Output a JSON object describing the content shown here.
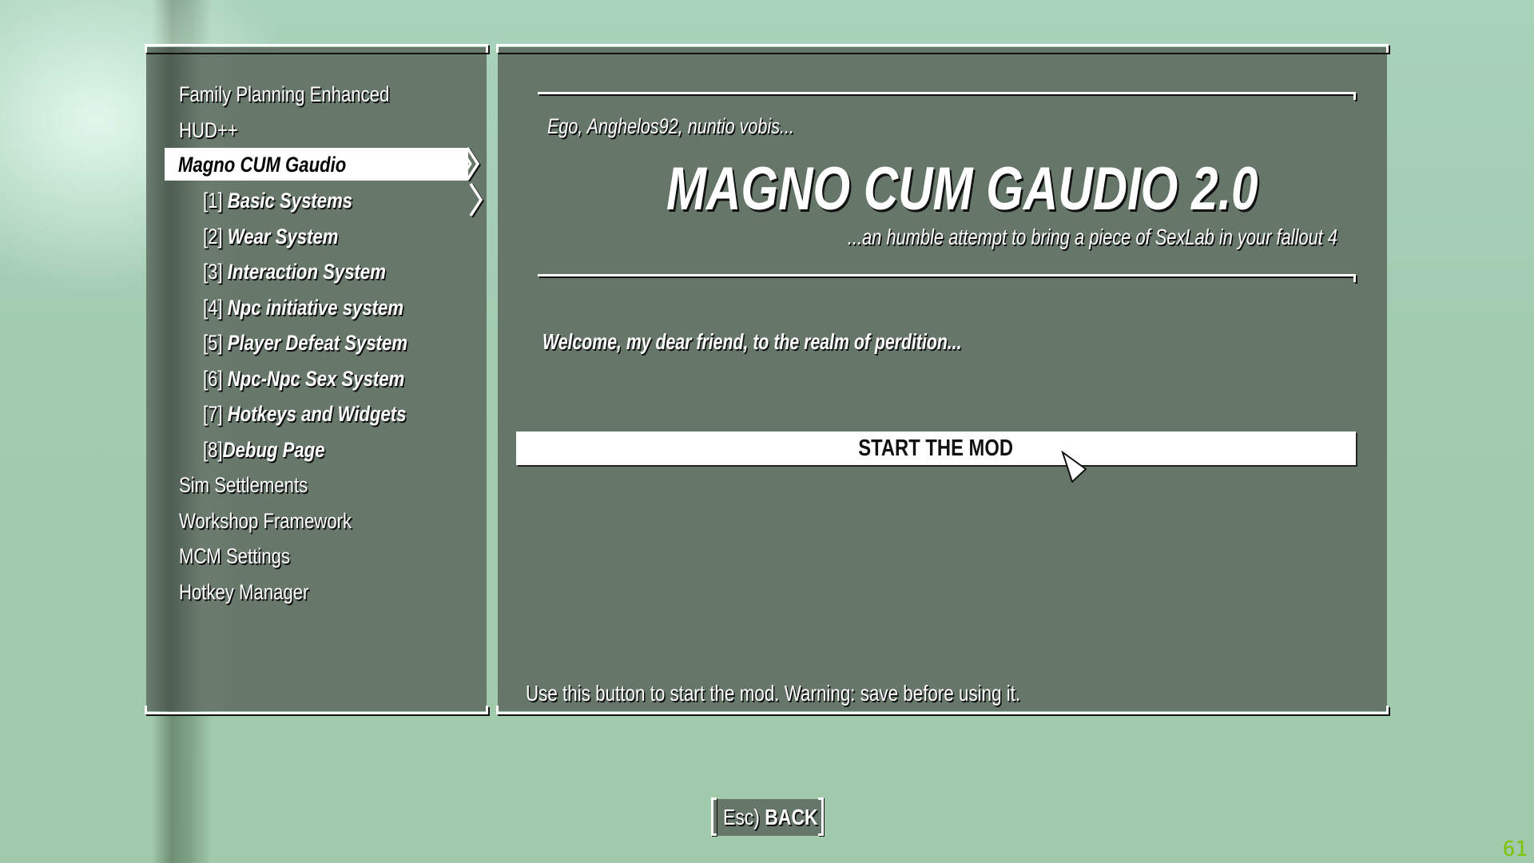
{
  "sidebar": {
    "items": [
      {
        "label": "Family Planning Enhanced"
      },
      {
        "label": "HUD++"
      },
      {
        "label": "Magno CUM Gaudio",
        "selected": true
      },
      {
        "num": "[1]",
        "label": "Basic Systems",
        "sub": true
      },
      {
        "num": "[2]",
        "label": "Wear System",
        "sub": true
      },
      {
        "num": "[3]",
        "label": "Interaction System",
        "sub": true
      },
      {
        "num": "[4]",
        "label": "Npc initiative system",
        "sub": true
      },
      {
        "num": "[5]",
        "label": "Player Defeat System",
        "sub": true
      },
      {
        "num": "[6]",
        "label": "Npc-Npc Sex System",
        "sub": true
      },
      {
        "num": "[7]",
        "label": "Hotkeys and Widgets",
        "sub": true
      },
      {
        "num": "[8]",
        "label": "Debug Page",
        "sub": true
      },
      {
        "label": "Sim Settlements"
      },
      {
        "label": "Workshop Framework"
      },
      {
        "label": "MCM Settings"
      },
      {
        "label": "Hotkey Manager"
      }
    ]
  },
  "content": {
    "intro": "Ego, Anghelos92, nuntio vobis...",
    "title": "MAGNO CUM GAUDIO 2.0",
    "tagline": "...an humble attempt to bring a piece of SexLab in your fallout 4",
    "welcome": "Welcome, my dear friend, to the realm of perdition...",
    "start_button": "START THE MOD",
    "help_text": "Use this button to start the mod. Warning: save before using it."
  },
  "footer": {
    "back_key": "Esc)",
    "back_label": "BACK"
  },
  "overlay": {
    "fps": "61",
    "fps_color": "#7bc400"
  },
  "colors": {
    "panel": "#67786b",
    "background": "#a2cbb0",
    "highlight": "#ffffff"
  }
}
